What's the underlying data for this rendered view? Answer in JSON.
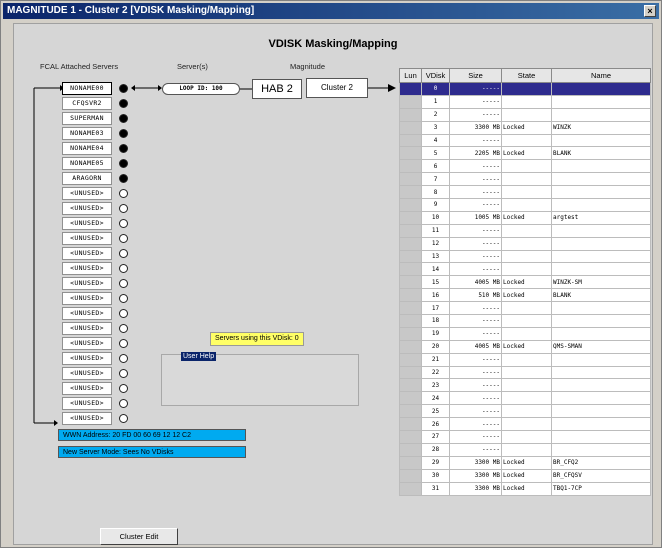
{
  "window": {
    "title": "MAGNITUDE 1 - Cluster 2 [VDISK Masking/Mapping]",
    "close_label": "×"
  },
  "page_title": "VDISK Masking/Mapping",
  "headers": {
    "fcal": "FCAL Attached Servers",
    "servers": "Server(s)",
    "magnitude": "Magnitude"
  },
  "servers": [
    {
      "name": "NONAME00",
      "attached": true,
      "selected": true
    },
    {
      "name": "CFQSVR2",
      "attached": true
    },
    {
      "name": "SUPERMAN",
      "attached": true
    },
    {
      "name": "NONAME03",
      "attached": true
    },
    {
      "name": "NONAME04",
      "attached": true
    },
    {
      "name": "NONAME05",
      "attached": true
    },
    {
      "name": "ARAGORN",
      "attached": true
    },
    {
      "name": "<UNUSED>",
      "attached": false
    },
    {
      "name": "<UNUSED>",
      "attached": false
    },
    {
      "name": "<UNUSED>",
      "attached": false
    },
    {
      "name": "<UNUSED>",
      "attached": false
    },
    {
      "name": "<UNUSED>",
      "attached": false
    },
    {
      "name": "<UNUSED>",
      "attached": false
    },
    {
      "name": "<UNUSED>",
      "attached": false
    },
    {
      "name": "<UNUSED>",
      "attached": false
    },
    {
      "name": "<UNUSED>",
      "attached": false
    },
    {
      "name": "<UNUSED>",
      "attached": false
    },
    {
      "name": "<UNUSED>",
      "attached": false
    },
    {
      "name": "<UNUSED>",
      "attached": false
    },
    {
      "name": "<UNUSED>",
      "attached": false
    },
    {
      "name": "<UNUSED>",
      "attached": false
    },
    {
      "name": "<UNUSED>",
      "attached": false
    },
    {
      "name": "<UNUSED>",
      "attached": false
    }
  ],
  "loop_id": "LOOP ID: 100",
  "hab": "HAB 2",
  "cluster": "Cluster 2",
  "servers_using": "Servers using this VDisk: 0",
  "user_help_label": "User Help",
  "wwn": "WWN Address: 20 FD 00 60 69 12 12 C2",
  "server_mode": "New Server Mode: Sees No VDisks",
  "cluster_edit_label": "Cluster Edit",
  "table": {
    "columns": [
      "Lun",
      "VDisk",
      "Size",
      "State",
      "Name"
    ],
    "selected_row": 0,
    "rows": [
      {
        "vdisk": "0",
        "size": "-----",
        "state": "",
        "name": ""
      },
      {
        "vdisk": "1",
        "size": "-----",
        "state": "",
        "name": ""
      },
      {
        "vdisk": "2",
        "size": "-----",
        "state": "",
        "name": ""
      },
      {
        "vdisk": "3",
        "size": "3300 MB",
        "state": "Locked",
        "name": "WINZK"
      },
      {
        "vdisk": "4",
        "size": "-----",
        "state": "",
        "name": ""
      },
      {
        "vdisk": "5",
        "size": "2205 MB",
        "state": "Locked",
        "name": "BLANK"
      },
      {
        "vdisk": "6",
        "size": "-----",
        "state": "",
        "name": ""
      },
      {
        "vdisk": "7",
        "size": "-----",
        "state": "",
        "name": ""
      },
      {
        "vdisk": "8",
        "size": "-----",
        "state": "",
        "name": ""
      },
      {
        "vdisk": "9",
        "size": "-----",
        "state": "",
        "name": ""
      },
      {
        "vdisk": "10",
        "size": "1005 MB",
        "state": "Locked",
        "name": "argtest"
      },
      {
        "vdisk": "11",
        "size": "-----",
        "state": "",
        "name": ""
      },
      {
        "vdisk": "12",
        "size": "-----",
        "state": "",
        "name": ""
      },
      {
        "vdisk": "13",
        "size": "-----",
        "state": "",
        "name": ""
      },
      {
        "vdisk": "14",
        "size": "-----",
        "state": "",
        "name": ""
      },
      {
        "vdisk": "15",
        "size": "4005 MB",
        "state": "Locked",
        "name": "WINZK-SM"
      },
      {
        "vdisk": "16",
        "size": "510 MB",
        "state": "Locked",
        "name": "BLANK"
      },
      {
        "vdisk": "17",
        "size": "-----",
        "state": "",
        "name": ""
      },
      {
        "vdisk": "18",
        "size": "-----",
        "state": "",
        "name": ""
      },
      {
        "vdisk": "19",
        "size": "-----",
        "state": "",
        "name": ""
      },
      {
        "vdisk": "20",
        "size": "4005 MB",
        "state": "Locked",
        "name": "QMS-SMAN"
      },
      {
        "vdisk": "21",
        "size": "-----",
        "state": "",
        "name": ""
      },
      {
        "vdisk": "22",
        "size": "-----",
        "state": "",
        "name": ""
      },
      {
        "vdisk": "23",
        "size": "-----",
        "state": "",
        "name": ""
      },
      {
        "vdisk": "24",
        "size": "-----",
        "state": "",
        "name": ""
      },
      {
        "vdisk": "25",
        "size": "-----",
        "state": "",
        "name": ""
      },
      {
        "vdisk": "26",
        "size": "-----",
        "state": "",
        "name": ""
      },
      {
        "vdisk": "27",
        "size": "-----",
        "state": "",
        "name": ""
      },
      {
        "vdisk": "28",
        "size": "-----",
        "state": "",
        "name": ""
      },
      {
        "vdisk": "29",
        "size": "3300 MB",
        "state": "Locked",
        "name": "BR_CFQ2"
      },
      {
        "vdisk": "30",
        "size": "3300 MB",
        "state": "Locked",
        "name": "BR_CFQSV"
      },
      {
        "vdisk": "31",
        "size": "3300 MB",
        "state": "Locked",
        "name": "TBQ1-7CP"
      }
    ]
  }
}
